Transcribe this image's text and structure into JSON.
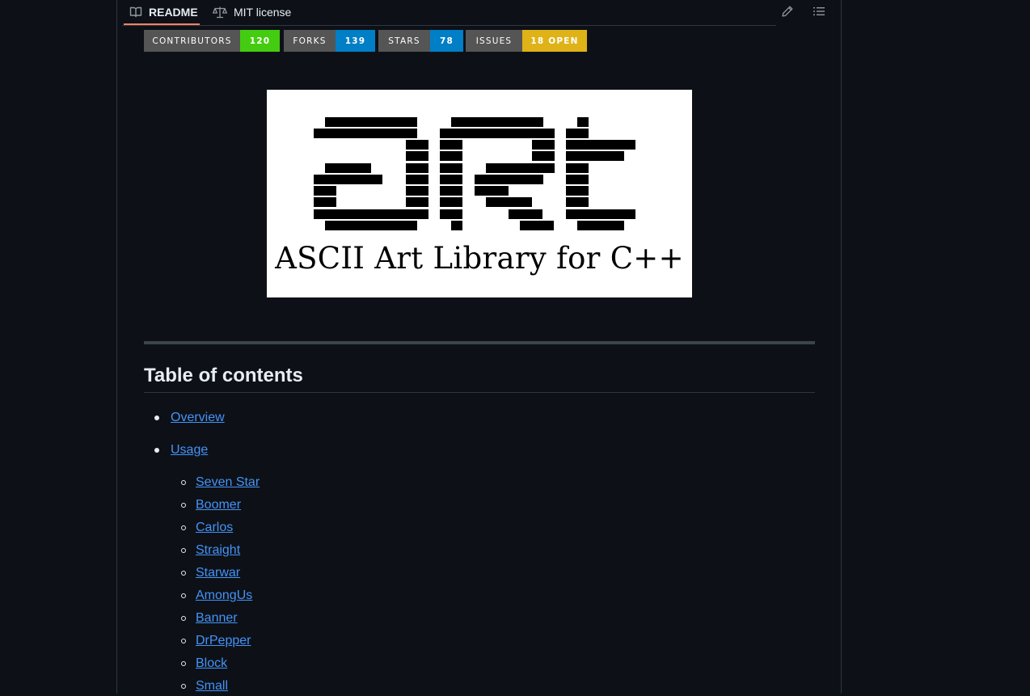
{
  "tabs": {
    "readme_label": "README",
    "license_label": "MIT license"
  },
  "badges": [
    {
      "label": "CONTRIBUTORS",
      "value": "120",
      "color": "#4c1"
    },
    {
      "label": "FORKS",
      "value": "139",
      "color": "#007ec6"
    },
    {
      "label": "STARS",
      "value": "78",
      "color": "#007ec6"
    },
    {
      "label": "ISSUES",
      "value": "18 OPEN",
      "color": "#dfb317"
    }
  ],
  "logo": {
    "caption": "ASCII Art Library for C++"
  },
  "toc": {
    "heading": "Table of contents",
    "items": [
      "Overview",
      "Usage"
    ],
    "sub_items": [
      "Seven Star",
      "Boomer",
      "Carlos",
      "Straight",
      "Starwar",
      "AmongUs",
      "Banner",
      "DrPepper",
      "Block",
      "Small"
    ]
  },
  "colors": {
    "background": "#0d1117",
    "link": "#4493f8",
    "tab_underline": "#f78166"
  },
  "icons": {
    "readme": "book-icon",
    "license": "law-scale-icon",
    "edit": "pencil-icon",
    "outline": "list-unordered-icon"
  }
}
